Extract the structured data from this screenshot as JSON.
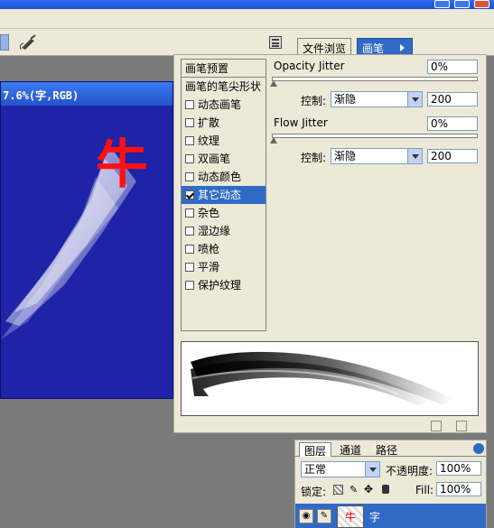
{
  "brushes_panel": {
    "tabs": [
      "文件浏览",
      "画笔"
    ],
    "list": {
      "header": "画笔预置",
      "items": [
        {
          "label": "画笔的笔尖形状",
          "checkbox": false,
          "checked": false,
          "selected": false
        },
        {
          "label": "动态画笔",
          "checkbox": true,
          "checked": false,
          "selected": false
        },
        {
          "label": "扩散",
          "checkbox": true,
          "checked": false,
          "selected": false
        },
        {
          "label": "纹理",
          "checkbox": true,
          "checked": false,
          "selected": false
        },
        {
          "label": "双画笔",
          "checkbox": true,
          "checked": false,
          "selected": false
        },
        {
          "label": "动态颜色",
          "checkbox": true,
          "checked": false,
          "selected": false
        },
        {
          "label": "其它动态",
          "checkbox": true,
          "checked": true,
          "selected": true
        },
        {
          "label": "杂色",
          "checkbox": true,
          "checked": false,
          "selected": false
        },
        {
          "label": "湿边缘",
          "checkbox": true,
          "checked": false,
          "selected": false
        },
        {
          "label": "喷枪",
          "checkbox": true,
          "checked": false,
          "selected": false
        },
        {
          "label": "平滑",
          "checkbox": true,
          "checked": false,
          "selected": false
        },
        {
          "label": "保护纹理",
          "checkbox": true,
          "checked": false,
          "selected": false
        }
      ]
    },
    "opacity_jitter": {
      "label": "Opacity Jitter",
      "value": "0%",
      "slider": 0
    },
    "opacity_control": {
      "label": "控制:",
      "option": "渐隐",
      "value": "200"
    },
    "flow_jitter": {
      "label": "Flow Jitter",
      "value": "0%",
      "slider": 0
    },
    "flow_control": {
      "label": "控制:",
      "option": "渐隐",
      "value": "200"
    }
  },
  "document": {
    "title_fragment": "7.6%(字,RGB)",
    "glyph": "牛"
  },
  "layers_panel": {
    "tabs": [
      "图层",
      "通道",
      "路径"
    ],
    "blend_mode": "正常",
    "opacity_label": "不透明度:",
    "opacity_value": "100%",
    "lock_label": "锁定:",
    "fill_label": "Fill:",
    "fill_value": "100%",
    "layer_name": "字"
  },
  "colors": {
    "accent": "#316ac5",
    "canvas": "#1e23a8",
    "glyph": "#ff0000"
  }
}
